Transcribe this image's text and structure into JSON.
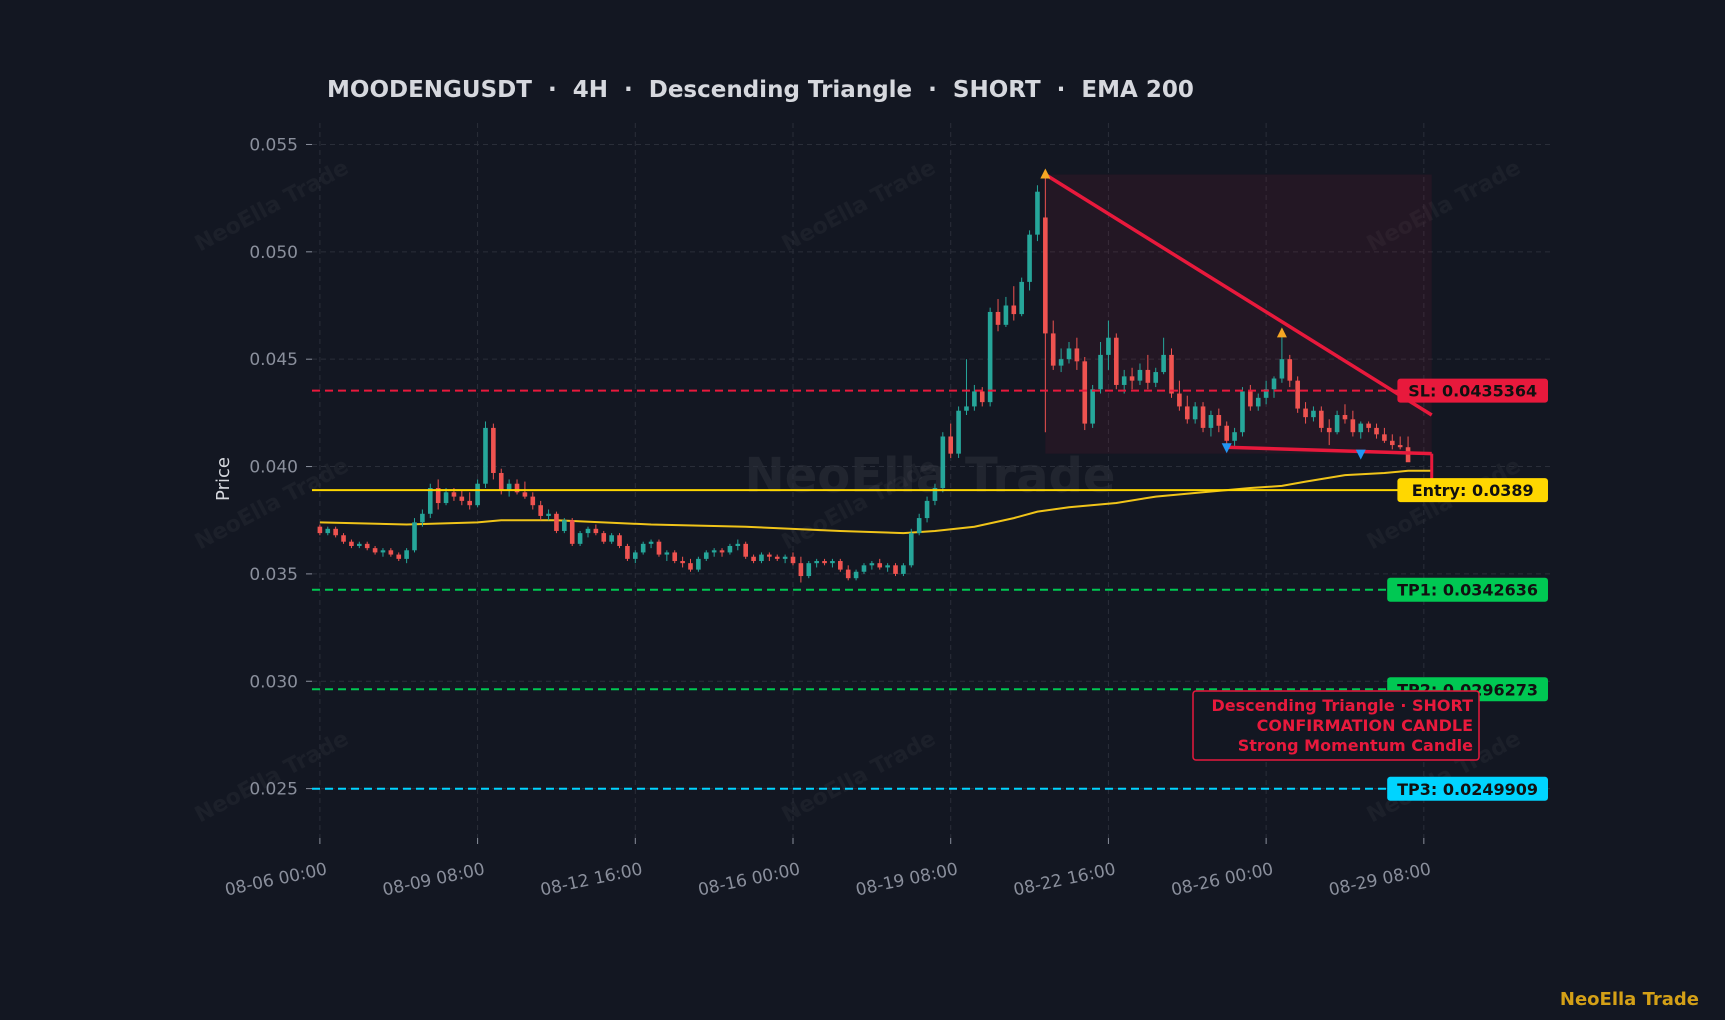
{
  "brand": "NeoElla Trade",
  "colors": {
    "background": "#131722",
    "grid": "#2a2e39",
    "bull": "#26a69a",
    "bear": "#ef5350",
    "ema": "#f0c419",
    "sl": "#e8193c",
    "tp1": "#00c853",
    "tp2": "#00c853",
    "tp3": "#00d4ff",
    "entry": "#ffd700",
    "triangle": "#e8193c"
  },
  "chart_data": {
    "type": "candlestick",
    "title": "MOODENGUSDT  ·  4H  ·  Descending Triangle  ·  SHORT  ·  EMA 200",
    "ylabel": "Price",
    "xlabel": "",
    "ylim": [
      0.0227,
      0.056
    ],
    "xlim": [
      "2025-08-05 20:00",
      "2025-09-01 00:00"
    ],
    "yticks": [
      "0.025",
      "0.030",
      "0.035",
      "0.040",
      "0.045",
      "0.050",
      "0.055"
    ],
    "xticks": [
      "08-06 00:00",
      "08-09 08:00",
      "08-12 16:00",
      "08-16 00:00",
      "08-19 08:00",
      "08-22 16:00",
      "08-26 00:00",
      "08-29 08:00"
    ],
    "grid": true,
    "watermark": "NeoElla Trade",
    "candles": [
      [
        "2025-08-06 00:00",
        0.0372,
        0.0373,
        0.0368,
        0.0369
      ],
      [
        "2025-08-06 04:00",
        0.0369,
        0.0372,
        0.0368,
        0.0371
      ],
      [
        "2025-08-06 08:00",
        0.0371,
        0.0372,
        0.0367,
        0.0368
      ],
      [
        "2025-08-06 12:00",
        0.0368,
        0.0369,
        0.0364,
        0.0365
      ],
      [
        "2025-08-06 16:00",
        0.0365,
        0.0366,
        0.0362,
        0.0363
      ],
      [
        "2025-08-06 20:00",
        0.0363,
        0.0365,
        0.0362,
        0.0364
      ],
      [
        "2025-08-07 00:00",
        0.0364,
        0.0365,
        0.0361,
        0.0362
      ],
      [
        "2025-08-07 04:00",
        0.0362,
        0.0363,
        0.0359,
        0.036
      ],
      [
        "2025-08-07 08:00",
        0.036,
        0.0362,
        0.0358,
        0.0361
      ],
      [
        "2025-08-07 12:00",
        0.0361,
        0.0362,
        0.0358,
        0.0359
      ],
      [
        "2025-08-07 16:00",
        0.0359,
        0.036,
        0.0356,
        0.0357
      ],
      [
        "2025-08-07 20:00",
        0.0357,
        0.0362,
        0.0355,
        0.0361
      ],
      [
        "2025-08-08 00:00",
        0.0361,
        0.0376,
        0.036,
        0.0374
      ],
      [
        "2025-08-08 04:00",
        0.0374,
        0.038,
        0.0372,
        0.0378
      ],
      [
        "2025-08-08 08:00",
        0.0378,
        0.0392,
        0.0376,
        0.039
      ],
      [
        "2025-08-08 12:00",
        0.039,
        0.0394,
        0.038,
        0.0383
      ],
      [
        "2025-08-08 16:00",
        0.0383,
        0.039,
        0.0382,
        0.0388
      ],
      [
        "2025-08-08 20:00",
        0.0388,
        0.039,
        0.0384,
        0.0386
      ],
      [
        "2025-08-09 00:00",
        0.0386,
        0.0389,
        0.0382,
        0.0384
      ],
      [
        "2025-08-09 04:00",
        0.0384,
        0.0388,
        0.038,
        0.0382
      ],
      [
        "2025-08-09 08:00",
        0.0382,
        0.0394,
        0.0381,
        0.0392
      ],
      [
        "2025-08-09 12:00",
        0.0392,
        0.0421,
        0.039,
        0.0418
      ],
      [
        "2025-08-09 16:00",
        0.0418,
        0.042,
        0.0394,
        0.0397
      ],
      [
        "2025-08-09 20:00",
        0.0397,
        0.0399,
        0.0387,
        0.0389
      ],
      [
        "2025-08-10 00:00",
        0.0389,
        0.0394,
        0.0386,
        0.0392
      ],
      [
        "2025-08-10 04:00",
        0.0392,
        0.0394,
        0.0387,
        0.0388
      ],
      [
        "2025-08-10 08:00",
        0.0388,
        0.0393,
        0.0385,
        0.0386
      ],
      [
        "2025-08-10 12:00",
        0.0386,
        0.0388,
        0.038,
        0.0382
      ],
      [
        "2025-08-10 16:00",
        0.0382,
        0.0384,
        0.0375,
        0.0377
      ],
      [
        "2025-08-10 20:00",
        0.0377,
        0.038,
        0.0375,
        0.0378
      ],
      [
        "2025-08-11 00:00",
        0.0378,
        0.0379,
        0.0369,
        0.037
      ],
      [
        "2025-08-11 04:00",
        0.037,
        0.0376,
        0.0369,
        0.0375
      ],
      [
        "2025-08-11 08:00",
        0.0375,
        0.0376,
        0.0363,
        0.0364
      ],
      [
        "2025-08-11 12:00",
        0.0364,
        0.037,
        0.0363,
        0.0369
      ],
      [
        "2025-08-11 16:00",
        0.0369,
        0.0372,
        0.0367,
        0.0371
      ],
      [
        "2025-08-11 20:00",
        0.0371,
        0.0373,
        0.0368,
        0.0369
      ],
      [
        "2025-08-12 00:00",
        0.0369,
        0.037,
        0.0364,
        0.0365
      ],
      [
        "2025-08-12 04:00",
        0.0365,
        0.0369,
        0.0364,
        0.0368
      ],
      [
        "2025-08-12 08:00",
        0.0368,
        0.0369,
        0.0362,
        0.0363
      ],
      [
        "2025-08-12 12:00",
        0.0363,
        0.0364,
        0.0356,
        0.0357
      ],
      [
        "2025-08-12 16:00",
        0.0357,
        0.0361,
        0.0355,
        0.036
      ],
      [
        "2025-08-12 20:00",
        0.036,
        0.0365,
        0.0359,
        0.0364
      ],
      [
        "2025-08-13 00:00",
        0.0364,
        0.0366,
        0.0362,
        0.0365
      ],
      [
        "2025-08-13 04:00",
        0.0365,
        0.0366,
        0.0358,
        0.0359
      ],
      [
        "2025-08-13 08:00",
        0.0359,
        0.0361,
        0.0356,
        0.036
      ],
      [
        "2025-08-13 12:00",
        0.036,
        0.0361,
        0.0355,
        0.0356
      ],
      [
        "2025-08-13 16:00",
        0.0356,
        0.0358,
        0.0353,
        0.0355
      ],
      [
        "2025-08-13 20:00",
        0.0355,
        0.0357,
        0.0351,
        0.0352
      ],
      [
        "2025-08-14 00:00",
        0.0352,
        0.0358,
        0.0351,
        0.0357
      ],
      [
        "2025-08-14 04:00",
        0.0357,
        0.0361,
        0.0356,
        0.036
      ],
      [
        "2025-08-14 08:00",
        0.036,
        0.0362,
        0.0358,
        0.0361
      ],
      [
        "2025-08-14 12:00",
        0.0361,
        0.0362,
        0.0358,
        0.036
      ],
      [
        "2025-08-14 16:00",
        0.036,
        0.0364,
        0.0359,
        0.0363
      ],
      [
        "2025-08-14 20:00",
        0.0363,
        0.0366,
        0.0361,
        0.0364
      ],
      [
        "2025-08-15 00:00",
        0.0364,
        0.0365,
        0.0357,
        0.0358
      ],
      [
        "2025-08-15 04:00",
        0.0358,
        0.0359,
        0.0355,
        0.0356
      ],
      [
        "2025-08-15 08:00",
        0.0356,
        0.036,
        0.0355,
        0.0359
      ],
      [
        "2025-08-15 12:00",
        0.0359,
        0.036,
        0.0356,
        0.0358
      ],
      [
        "2025-08-15 16:00",
        0.0358,
        0.0359,
        0.0356,
        0.0357
      ],
      [
        "2025-08-15 20:00",
        0.0357,
        0.0359,
        0.0355,
        0.0358
      ],
      [
        "2025-08-16 00:00",
        0.0358,
        0.036,
        0.0354,
        0.0355
      ],
      [
        "2025-08-16 04:00",
        0.0355,
        0.0358,
        0.0346,
        0.0349
      ],
      [
        "2025-08-16 08:00",
        0.0349,
        0.0356,
        0.0348,
        0.0355
      ],
      [
        "2025-08-16 12:00",
        0.0355,
        0.0357,
        0.0353,
        0.0356
      ],
      [
        "2025-08-16 16:00",
        0.0356,
        0.0357,
        0.0354,
        0.0355
      ],
      [
        "2025-08-16 20:00",
        0.0355,
        0.0357,
        0.0353,
        0.0356
      ],
      [
        "2025-08-17 00:00",
        0.0356,
        0.0357,
        0.0351,
        0.0352
      ],
      [
        "2025-08-17 04:00",
        0.0352,
        0.0354,
        0.0347,
        0.0348
      ],
      [
        "2025-08-17 08:00",
        0.0348,
        0.0352,
        0.0347,
        0.0351
      ],
      [
        "2025-08-17 12:00",
        0.0351,
        0.0355,
        0.035,
        0.0354
      ],
      [
        "2025-08-17 16:00",
        0.0354,
        0.0356,
        0.0352,
        0.0355
      ],
      [
        "2025-08-17 20:00",
        0.0355,
        0.0357,
        0.0352,
        0.0353
      ],
      [
        "2025-08-18 00:00",
        0.0353,
        0.0355,
        0.0351,
        0.0354
      ],
      [
        "2025-08-18 04:00",
        0.0354,
        0.0355,
        0.0349,
        0.035
      ],
      [
        "2025-08-18 08:00",
        0.035,
        0.0355,
        0.0349,
        0.0354
      ],
      [
        "2025-08-18 12:00",
        0.0354,
        0.0371,
        0.0353,
        0.0369
      ],
      [
        "2025-08-18 16:00",
        0.0369,
        0.0378,
        0.0368,
        0.0376
      ],
      [
        "2025-08-18 20:00",
        0.0376,
        0.0386,
        0.0374,
        0.0384
      ],
      [
        "2025-08-19 00:00",
        0.0384,
        0.0392,
        0.0382,
        0.039
      ],
      [
        "2025-08-19 04:00",
        0.039,
        0.0416,
        0.0388,
        0.0414
      ],
      [
        "2025-08-19 08:00",
        0.0414,
        0.042,
        0.0404,
        0.0406
      ],
      [
        "2025-08-19 12:00",
        0.0406,
        0.0428,
        0.0404,
        0.0426
      ],
      [
        "2025-08-19 16:00",
        0.0426,
        0.045,
        0.0424,
        0.0428
      ],
      [
        "2025-08-19 20:00",
        0.0428,
        0.0438,
        0.0426,
        0.0435
      ],
      [
        "2025-08-20 00:00",
        0.0435,
        0.0437,
        0.0428,
        0.043
      ],
      [
        "2025-08-20 04:00",
        0.043,
        0.0474,
        0.0428,
        0.0472
      ],
      [
        "2025-08-20 08:00",
        0.0472,
        0.0478,
        0.0463,
        0.0466
      ],
      [
        "2025-08-20 12:00",
        0.0466,
        0.0479,
        0.0465,
        0.0475
      ],
      [
        "2025-08-20 16:00",
        0.0475,
        0.0484,
        0.0468,
        0.0471
      ],
      [
        "2025-08-20 20:00",
        0.0471,
        0.0488,
        0.047,
        0.0486
      ],
      [
        "2025-08-21 00:00",
        0.0486,
        0.051,
        0.0482,
        0.0508
      ],
      [
        "2025-08-21 04:00",
        0.0508,
        0.0531,
        0.0505,
        0.0528
      ],
      [
        "2025-08-21 08:00",
        0.0516,
        0.0536,
        0.0416,
        0.0462
      ],
      [
        "2025-08-21 12:00",
        0.0462,
        0.0468,
        0.0445,
        0.0447
      ],
      [
        "2025-08-21 16:00",
        0.0447,
        0.0455,
        0.0444,
        0.045
      ],
      [
        "2025-08-21 20:00",
        0.045,
        0.0458,
        0.0448,
        0.0455
      ],
      [
        "2025-08-22 00:00",
        0.0455,
        0.046,
        0.0445,
        0.0449
      ],
      [
        "2025-08-22 04:00",
        0.0449,
        0.0451,
        0.0417,
        0.042
      ],
      [
        "2025-08-22 08:00",
        0.042,
        0.0438,
        0.0418,
        0.0436
      ],
      [
        "2025-08-22 12:00",
        0.0436,
        0.0458,
        0.0434,
        0.0452
      ],
      [
        "2025-08-22 16:00",
        0.0452,
        0.0468,
        0.0445,
        0.046
      ],
      [
        "2025-08-22 20:00",
        0.046,
        0.0462,
        0.0436,
        0.0438
      ],
      [
        "2025-08-23 00:00",
        0.0438,
        0.0445,
        0.0434,
        0.0442
      ],
      [
        "2025-08-23 04:00",
        0.0442,
        0.0446,
        0.0436,
        0.044
      ],
      [
        "2025-08-23 08:00",
        0.044,
        0.0448,
        0.0438,
        0.0445
      ],
      [
        "2025-08-23 12:00",
        0.0445,
        0.0452,
        0.0436,
        0.0439
      ],
      [
        "2025-08-23 16:00",
        0.0439,
        0.0446,
        0.0437,
        0.0444
      ],
      [
        "2025-08-23 20:00",
        0.0444,
        0.046,
        0.0443,
        0.0452
      ],
      [
        "2025-08-24 00:00",
        0.0452,
        0.0455,
        0.0432,
        0.0434
      ],
      [
        "2025-08-24 04:00",
        0.0434,
        0.044,
        0.0426,
        0.0428
      ],
      [
        "2025-08-24 08:00",
        0.0428,
        0.0433,
        0.042,
        0.0422
      ],
      [
        "2025-08-24 12:00",
        0.0422,
        0.043,
        0.042,
        0.0428
      ],
      [
        "2025-08-24 16:00",
        0.0428,
        0.043,
        0.0416,
        0.0418
      ],
      [
        "2025-08-24 20:00",
        0.0418,
        0.0426,
        0.0414,
        0.0424
      ],
      [
        "2025-08-25 00:00",
        0.0424,
        0.0427,
        0.0416,
        0.0419
      ],
      [
        "2025-08-25 04:00",
        0.0419,
        0.0421,
        0.041,
        0.0412
      ],
      [
        "2025-08-25 08:00",
        0.0412,
        0.0418,
        0.0409,
        0.0416
      ],
      [
        "2025-08-25 12:00",
        0.0416,
        0.0437,
        0.0414,
        0.0435
      ],
      [
        "2025-08-25 16:00",
        0.0435,
        0.0438,
        0.0426,
        0.0428
      ],
      [
        "2025-08-25 20:00",
        0.0428,
        0.0434,
        0.0426,
        0.0432
      ],
      [
        "2025-08-26 00:00",
        0.0432,
        0.044,
        0.0429,
        0.0436
      ],
      [
        "2025-08-26 04:00",
        0.0436,
        0.0442,
        0.0432,
        0.0441
      ],
      [
        "2025-08-26 08:00",
        0.0441,
        0.0462,
        0.0439,
        0.045
      ],
      [
        "2025-08-26 12:00",
        0.045,
        0.0452,
        0.0437,
        0.044
      ],
      [
        "2025-08-26 16:00",
        0.044,
        0.0442,
        0.0425,
        0.0427
      ],
      [
        "2025-08-26 20:00",
        0.0427,
        0.043,
        0.042,
        0.0423
      ],
      [
        "2025-08-27 00:00",
        0.0423,
        0.0428,
        0.0421,
        0.0426
      ],
      [
        "2025-08-27 04:00",
        0.0426,
        0.0428,
        0.0416,
        0.0418
      ],
      [
        "2025-08-27 08:00",
        0.0418,
        0.0422,
        0.041,
        0.0416
      ],
      [
        "2025-08-27 12:00",
        0.0416,
        0.0426,
        0.0415,
        0.0424
      ],
      [
        "2025-08-27 16:00",
        0.0424,
        0.0429,
        0.042,
        0.0422
      ],
      [
        "2025-08-27 20:00",
        0.0422,
        0.0426,
        0.0414,
        0.0416
      ],
      [
        "2025-08-28 00:00",
        0.0416,
        0.0421,
        0.0413,
        0.042
      ],
      [
        "2025-08-28 04:00",
        0.042,
        0.0421,
        0.0416,
        0.0418
      ],
      [
        "2025-08-28 08:00",
        0.0418,
        0.042,
        0.0413,
        0.0415
      ],
      [
        "2025-08-28 12:00",
        0.0415,
        0.0418,
        0.0411,
        0.0412
      ],
      [
        "2025-08-28 16:00",
        0.0412,
        0.0415,
        0.0408,
        0.041
      ],
      [
        "2025-08-28 20:00",
        0.041,
        0.0414,
        0.0408,
        0.0409
      ],
      [
        "2025-08-29 00:00",
        0.0409,
        0.0414,
        0.0404,
        0.0402
      ]
    ],
    "ema200": [
      [
        "2025-08-06 00:00",
        0.0374
      ],
      [
        "2025-08-07 20:00",
        0.0373
      ],
      [
        "2025-08-09 08:00",
        0.0374
      ],
      [
        "2025-08-09 20:00",
        0.0375
      ],
      [
        "2025-08-11 00:00",
        0.0375
      ],
      [
        "2025-08-13 00:00",
        0.0373
      ],
      [
        "2025-08-15 00:00",
        0.0372
      ],
      [
        "2025-08-17 00:00",
        0.037
      ],
      [
        "2025-08-18 08:00",
        0.0369
      ],
      [
        "2025-08-19 00:00",
        0.037
      ],
      [
        "2025-08-19 20:00",
        0.0372
      ],
      [
        "2025-08-20 16:00",
        0.0376
      ],
      [
        "2025-08-21 04:00",
        0.0379
      ],
      [
        "2025-08-21 20:00",
        0.0381
      ],
      [
        "2025-08-22 20:00",
        0.0383
      ],
      [
        "2025-08-23 16:00",
        0.0386
      ],
      [
        "2025-08-24 16:00",
        0.0388
      ],
      [
        "2025-08-25 16:00",
        0.039
      ],
      [
        "2025-08-26 08:00",
        0.0391
      ],
      [
        "2025-08-26 20:00",
        0.0393
      ],
      [
        "2025-08-27 16:00",
        0.0396
      ],
      [
        "2025-08-28 12:00",
        0.0397
      ],
      [
        "2025-08-29 00:00",
        0.0398
      ],
      [
        "2025-08-29 12:00",
        0.0398
      ]
    ],
    "levels": [
      {
        "key": "sl",
        "label": "SL: 0.0435364",
        "value": 0.0435364,
        "style": "dashed"
      },
      {
        "key": "entry",
        "label": "Entry: 0.0389",
        "value": 0.0389,
        "style": "solid"
      },
      {
        "key": "tp1",
        "label": "TP1: 0.0342636",
        "value": 0.0342636,
        "style": "dashed"
      },
      {
        "key": "tp2",
        "label": "TP2: 0.0296273",
        "value": 0.0296273,
        "style": "dashed"
      },
      {
        "key": "tp3",
        "label": "TP3: 0.0249909",
        "value": 0.0249909,
        "style": "dashed"
      }
    ],
    "triangle": {
      "upper": [
        [
          "2025-08-21 08:00",
          0.0536
        ],
        [
          "2025-08-29 12:00",
          0.0424
        ]
      ],
      "lower": [
        [
          "2025-08-25 04:00",
          0.0409
        ],
        [
          "2025-08-29 12:00",
          0.0406
        ]
      ],
      "zone_top": 0.0536,
      "zone_bottom": 0.0406,
      "peaks": [
        [
          "2025-08-21 08:00",
          0.0536
        ],
        [
          "2025-08-26 08:00",
          0.0462
        ]
      ],
      "troughs": [
        [
          "2025-08-25 04:00",
          0.0409
        ],
        [
          "2025-08-28 00:00",
          0.0406
        ]
      ],
      "signal": [
        "2025-08-29 12:00",
        0.0393
      ]
    },
    "annotation": [
      "Descending Triangle · SHORT",
      "CONFIRMATION CANDLE",
      "Strong Momentum Candle"
    ]
  }
}
